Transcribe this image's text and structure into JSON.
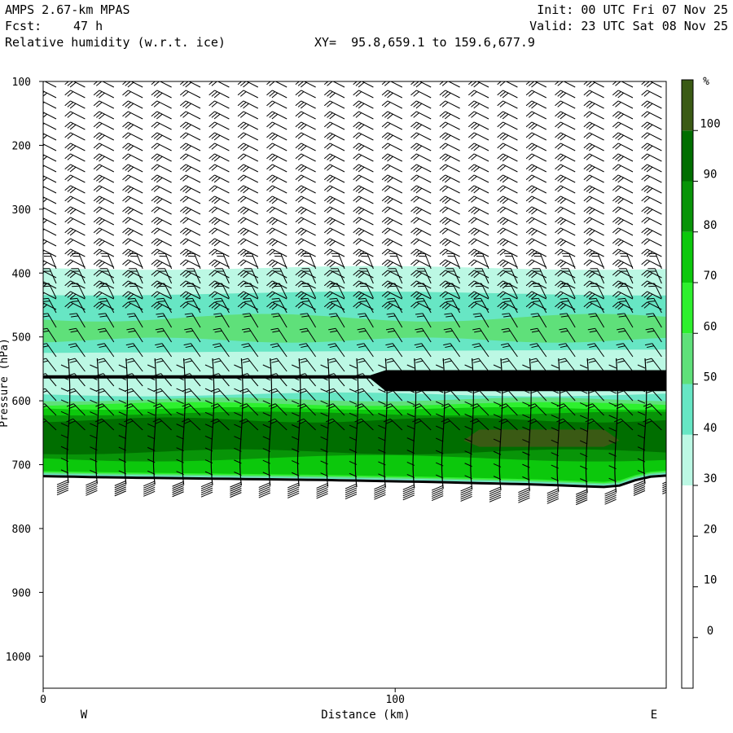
{
  "header": {
    "model": "AMPS 2.67-km MPAS",
    "fcst_label": "Fcst:",
    "fcst_value": "47 h",
    "field": "Relative humidity (w.r.t. ice)",
    "xy": "XY=  95.8,659.1 to 159.6,677.9",
    "init": "Init: 00 UTC Fri 07 Nov 25",
    "valid": "Valid: 23 UTC Sat 08 Nov 25"
  },
  "chart_data": {
    "type": "cross-section",
    "title": "Relative humidity (w.r.t. ice)",
    "xlabel": "Distance (km)",
    "ylabel": "Pressure (hPa)",
    "x_ticks": [
      0,
      100
    ],
    "x_side_labels": [
      "W",
      "E"
    ],
    "xlim": [
      0,
      177
    ],
    "y_ticks": [
      100,
      200,
      300,
      400,
      500,
      600,
      700,
      800,
      900,
      1000
    ],
    "ylim": [
      100,
      1050
    ],
    "y_inverted": true,
    "colorbar": {
      "unit": "%",
      "levels": [
        0,
        10,
        20,
        30,
        40,
        50,
        60,
        70,
        80,
        90,
        100
      ],
      "colors": [
        "#ffffff",
        "#ffffff",
        "#ffffff",
        "#ffffff",
        "#bcf8e4",
        "#67e6c4",
        "#5fe07a",
        "#2ef02e",
        "#0cc80c",
        "#089408",
        "#006e00",
        "#3a5a14"
      ]
    },
    "rh_bands": [
      {
        "name": "moist-lower",
        "p_top": 600,
        "p_bottom": 720,
        "rh": [
          60,
          100
        ]
      },
      {
        "name": "mid-dry",
        "p_top": 530,
        "p_bottom": 600,
        "rh": [
          10,
          40
        ]
      },
      {
        "name": "mid-moist",
        "p_top": 390,
        "p_bottom": 530,
        "rh": [
          30,
          60
        ]
      },
      {
        "name": "upper-dry",
        "p_top": 100,
        "p_bottom": 390,
        "rh": [
          0,
          30
        ]
      }
    ],
    "terrain_surface_hPa": {
      "x": [
        0,
        20,
        50,
        80,
        110,
        140,
        160,
        165,
        170,
        177
      ],
      "p": [
        718,
        720,
        722,
        724,
        727,
        731,
        735,
        732,
        720,
        717
      ]
    },
    "wind_barbs": true
  }
}
